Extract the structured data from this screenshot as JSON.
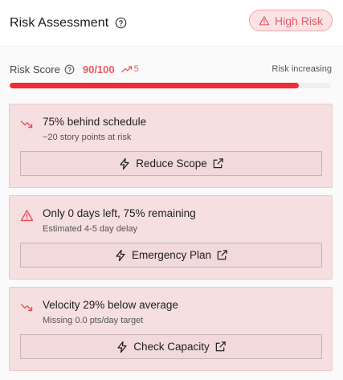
{
  "header": {
    "title": "Risk Assessment",
    "badge_label": "High Risk"
  },
  "score": {
    "label": "Risk Score",
    "value": "90/100",
    "trend": "5",
    "status": "Risk increasing",
    "progress_fraction": 0.9
  },
  "cards": [
    {
      "icon": "trending-down-icon",
      "title": "75% behind schedule",
      "subtitle": "~20 story points at risk",
      "button_label": "Reduce Scope"
    },
    {
      "icon": "warning-triangle-icon",
      "title": "Only 0 days left, 75% remaining",
      "subtitle": "Estimated 4-5 day delay",
      "button_label": "Emergency Plan"
    },
    {
      "icon": "trending-down-icon",
      "title": "Velocity 29% below average",
      "subtitle": "Missing 0.0 pts/day target",
      "button_label": "Check Capacity"
    }
  ],
  "colors": {
    "accent": "#ea5a62",
    "progress": "#ef2b34",
    "card_bg": "#f6dfe1",
    "badge_bg": "#fbe3e5"
  }
}
